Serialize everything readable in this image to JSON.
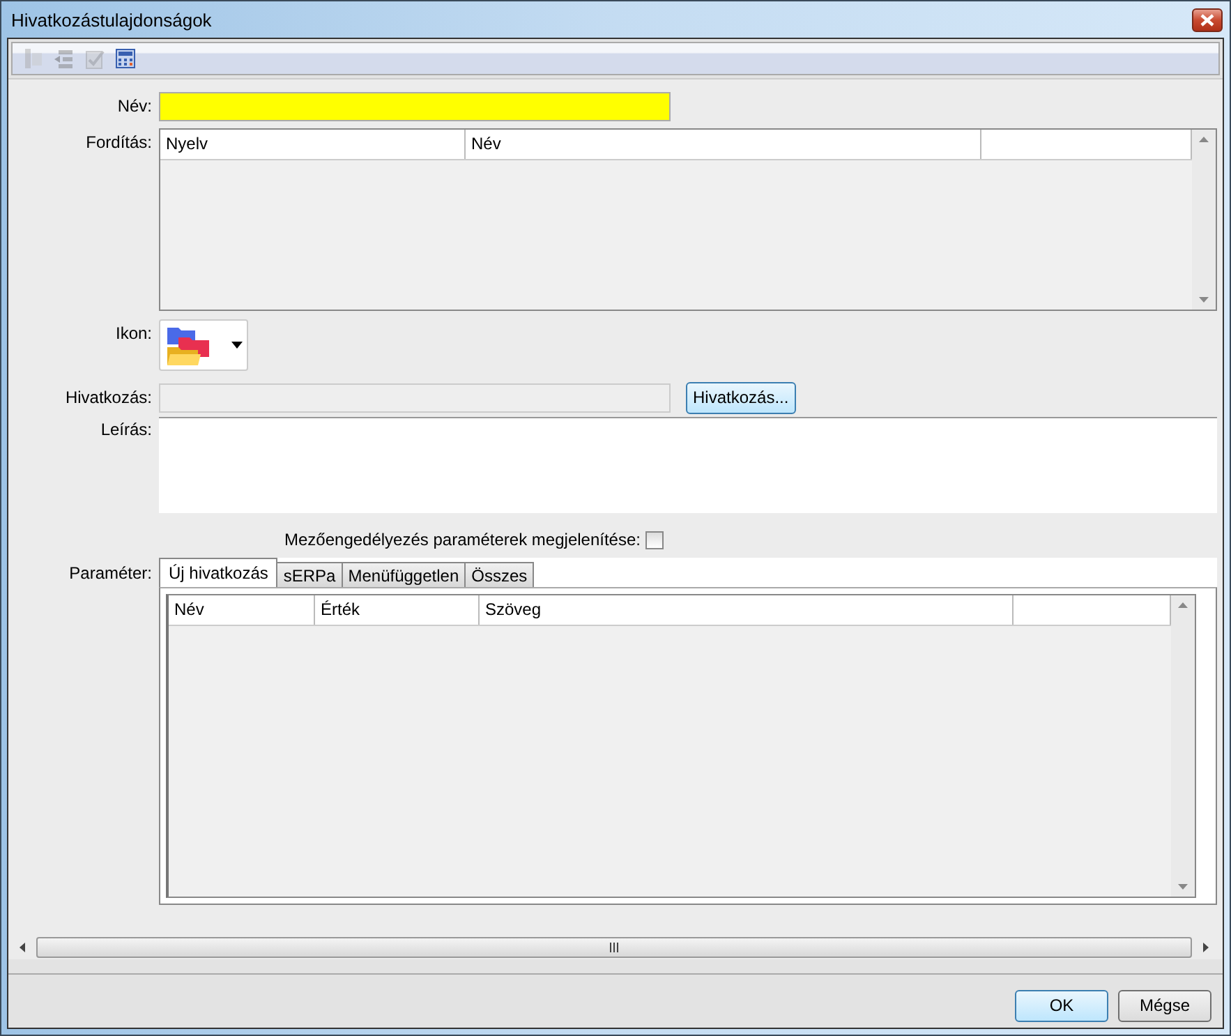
{
  "window": {
    "title": "Hivatkozástulajdonságok"
  },
  "toolbar": [
    {
      "disabled": true
    },
    {
      "disabled": true
    },
    {
      "disabled": true
    },
    {
      "disabled": false
    }
  ],
  "name_field": {
    "label": "Név:"
  },
  "translations": {
    "label": "Fordítás:",
    "columns": [
      "Nyelv",
      "Név"
    ]
  },
  "icon_field": {
    "label": "Ikon:"
  },
  "link": {
    "label": "Hivatkozás:",
    "button": "Hivatkozás...",
    "disabled": true
  },
  "description": {
    "label": "Leírás:"
  },
  "field_permission": {
    "label": "Mezőengedélyezés paraméterek megjelenítése:",
    "checked": false
  },
  "parameters": {
    "label": "Paraméter:",
    "tabs": [
      {
        "label": "Új hivatkozás",
        "selected": true
      },
      {
        "label": "sERPa",
        "selected": false
      },
      {
        "label": "Menüfüggetlen",
        "selected": false
      },
      {
        "label": "Összes",
        "selected": false
      }
    ],
    "columns": [
      "Név",
      "Érték",
      "Szöveg"
    ]
  },
  "buttons": [
    {
      "label": "OK",
      "default": true
    },
    {
      "label": "Mégse",
      "default": false
    }
  ]
}
